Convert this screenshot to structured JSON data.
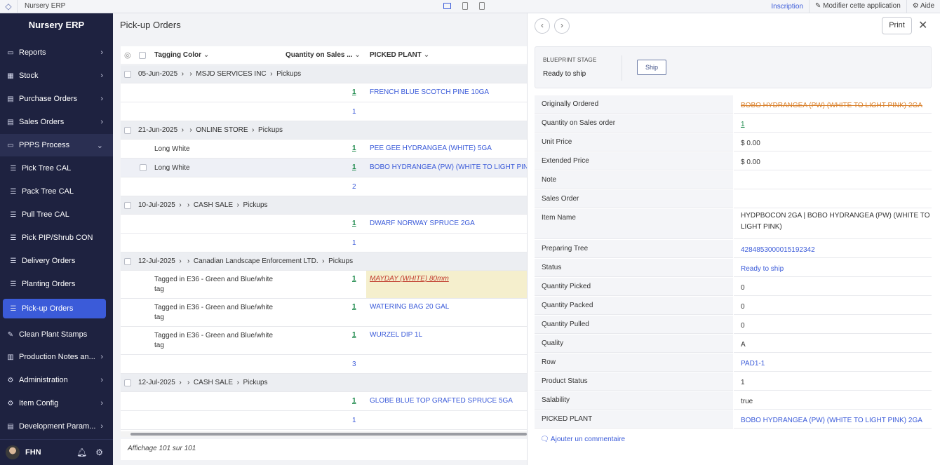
{
  "app": {
    "name": "Nursery ERP",
    "links": {
      "signup": "Inscription",
      "modify": "Modifier cette application",
      "help": "Aide"
    }
  },
  "sidebar": {
    "brand": "Nursery ERP",
    "items": [
      {
        "label": "Reports",
        "icon": "monitor-icon",
        "chev": "›"
      },
      {
        "label": "Stock",
        "icon": "grid-icon",
        "chev": "›"
      },
      {
        "label": "Purchase Orders",
        "icon": "document-icon",
        "chev": "›"
      },
      {
        "label": "Sales Orders",
        "icon": "document-icon",
        "chev": "›"
      },
      {
        "label": "PPPS Process",
        "icon": "monitor-icon",
        "chev": "⌄"
      },
      {
        "label": "Pick Tree CAL",
        "icon": "list-icon"
      },
      {
        "label": "Pack Tree CAL",
        "icon": "list-icon"
      },
      {
        "label": "Pull Tree CAL",
        "icon": "list-icon"
      },
      {
        "label": "Pick PIP/Shrub CON",
        "icon": "list-icon"
      },
      {
        "label": "Delivery Orders",
        "icon": "list-icon"
      },
      {
        "label": "Planting Orders",
        "icon": "list-icon"
      },
      {
        "label": "Pick-up Orders",
        "icon": "list-icon"
      },
      {
        "label": "Clean Plant Stamps",
        "icon": "stamp-icon"
      },
      {
        "label": "Production Notes an...",
        "icon": "layout-icon",
        "chev": "›"
      },
      {
        "label": "Administration",
        "icon": "gear-icon",
        "chev": "›"
      },
      {
        "label": "Item Config",
        "icon": "gear-icon",
        "chev": "›"
      },
      {
        "label": "Development Param...",
        "icon": "document-icon",
        "chev": "›"
      }
    ],
    "user": "FHN"
  },
  "main": {
    "title": "Pick-up Orders",
    "columns": {
      "tagging": "Tagging Color",
      "qty": "Quantity on Sales ...",
      "picked": "PICKED PLANT"
    },
    "rows": [
      {
        "type": "group",
        "date": "05-Jun-2025",
        "customer": "MSJD SERVICES INC",
        "tail": "Pickups"
      },
      {
        "type": "item",
        "tag": "",
        "qty": "1",
        "plant": "FRENCH BLUE SCOTCH PINE 10GA"
      },
      {
        "type": "sum",
        "qty": "1"
      },
      {
        "type": "group",
        "date": "21-Jun-2025",
        "customer": "ONLINE STORE",
        "tail": "Pickups"
      },
      {
        "type": "item",
        "tag": "Long White",
        "qty": "1",
        "plant": "PEE GEE HYDRANGEA (WHITE) 5GA"
      },
      {
        "type": "item",
        "tag": "Long White",
        "qty": "1",
        "plant": "BOBO HYDRANGEA (PW) (WHITE TO LIGHT PIN"
      },
      {
        "type": "sum",
        "qty": "2"
      },
      {
        "type": "group",
        "date": "10-Jul-2025",
        "customer": "CASH SALE",
        "tail": "Pickups"
      },
      {
        "type": "item",
        "tag": "",
        "qty": "1",
        "plant": "DWARF NORWAY SPRUCE 2GA"
      },
      {
        "type": "sum",
        "qty": "1"
      },
      {
        "type": "group",
        "date": "12-Jul-2025",
        "customer": "Canadian Landscape Enforcement LTD.",
        "tail": "Pickups"
      },
      {
        "type": "item2",
        "tag": "Tagged in E36 - Green and Blue/white tag",
        "qty": "1",
        "plant": "MAYDAY (WHITE) 80mm"
      },
      {
        "type": "item2",
        "tag": "Tagged in E36 - Green and Blue/white tag",
        "qty": "1",
        "plant": "WATERING BAG 20 GAL"
      },
      {
        "type": "item2",
        "tag": "Tagged in E36 - Green and Blue/white tag",
        "qty": "1",
        "plant": "WURZEL DIP 1L"
      },
      {
        "type": "sum",
        "qty": "3"
      },
      {
        "type": "group",
        "date": "12-Jul-2025",
        "customer": "CASH SALE",
        "tail": "Pickups"
      },
      {
        "type": "item",
        "tag": "",
        "qty": "1",
        "plant": "GLOBE BLUE TOP GRAFTED SPRUCE 5GA"
      },
      {
        "type": "sum",
        "qty": "1"
      }
    ],
    "footer": "Affichage 101 sur 101"
  },
  "detail": {
    "print": "Print",
    "stage_label": "BLUEPRINT STAGE",
    "stage_value": "Ready to ship",
    "ship": "Ship",
    "fields": [
      {
        "k": "Originally Ordered",
        "v": "BOBO HYDRANGEA (PW) (WHITE TO LIGHT PINK) 2GA",
        "style": "strike"
      },
      {
        "k": "Quantity on Sales order",
        "v": "1",
        "style": "qty"
      },
      {
        "k": "Unit Price",
        "v": "$ 0.00"
      },
      {
        "k": "Extended Price",
        "v": "$ 0.00"
      },
      {
        "k": "Note",
        "v": ""
      },
      {
        "k": "Sales Order",
        "v": ""
      },
      {
        "k": "Item Name",
        "v": "HYDPBOCON 2GA | BOBO HYDRANGEA (PW) (WHITE TO LIGHT PINK)",
        "tall": true
      },
      {
        "k": "Preparing Tree",
        "v": "4284853000015192342",
        "style": "link"
      },
      {
        "k": "Status",
        "v": "Ready to ship",
        "style": "link"
      },
      {
        "k": "Quantity Picked",
        "v": "0"
      },
      {
        "k": "Quantity Packed",
        "v": "0"
      },
      {
        "k": "Quantity Pulled",
        "v": "0"
      },
      {
        "k": "Quality",
        "v": "A"
      },
      {
        "k": "Row",
        "v": "PAD1-1",
        "style": "link"
      },
      {
        "k": "Product Status",
        "v": "1"
      },
      {
        "k": "Salability",
        "v": "true"
      },
      {
        "k": "PICKED PLANT",
        "v": "BOBO HYDRANGEA (PW) (WHITE TO LIGHT PINK) 2GA",
        "style": "link"
      }
    ],
    "comment": "Ajouter un commentaire"
  }
}
